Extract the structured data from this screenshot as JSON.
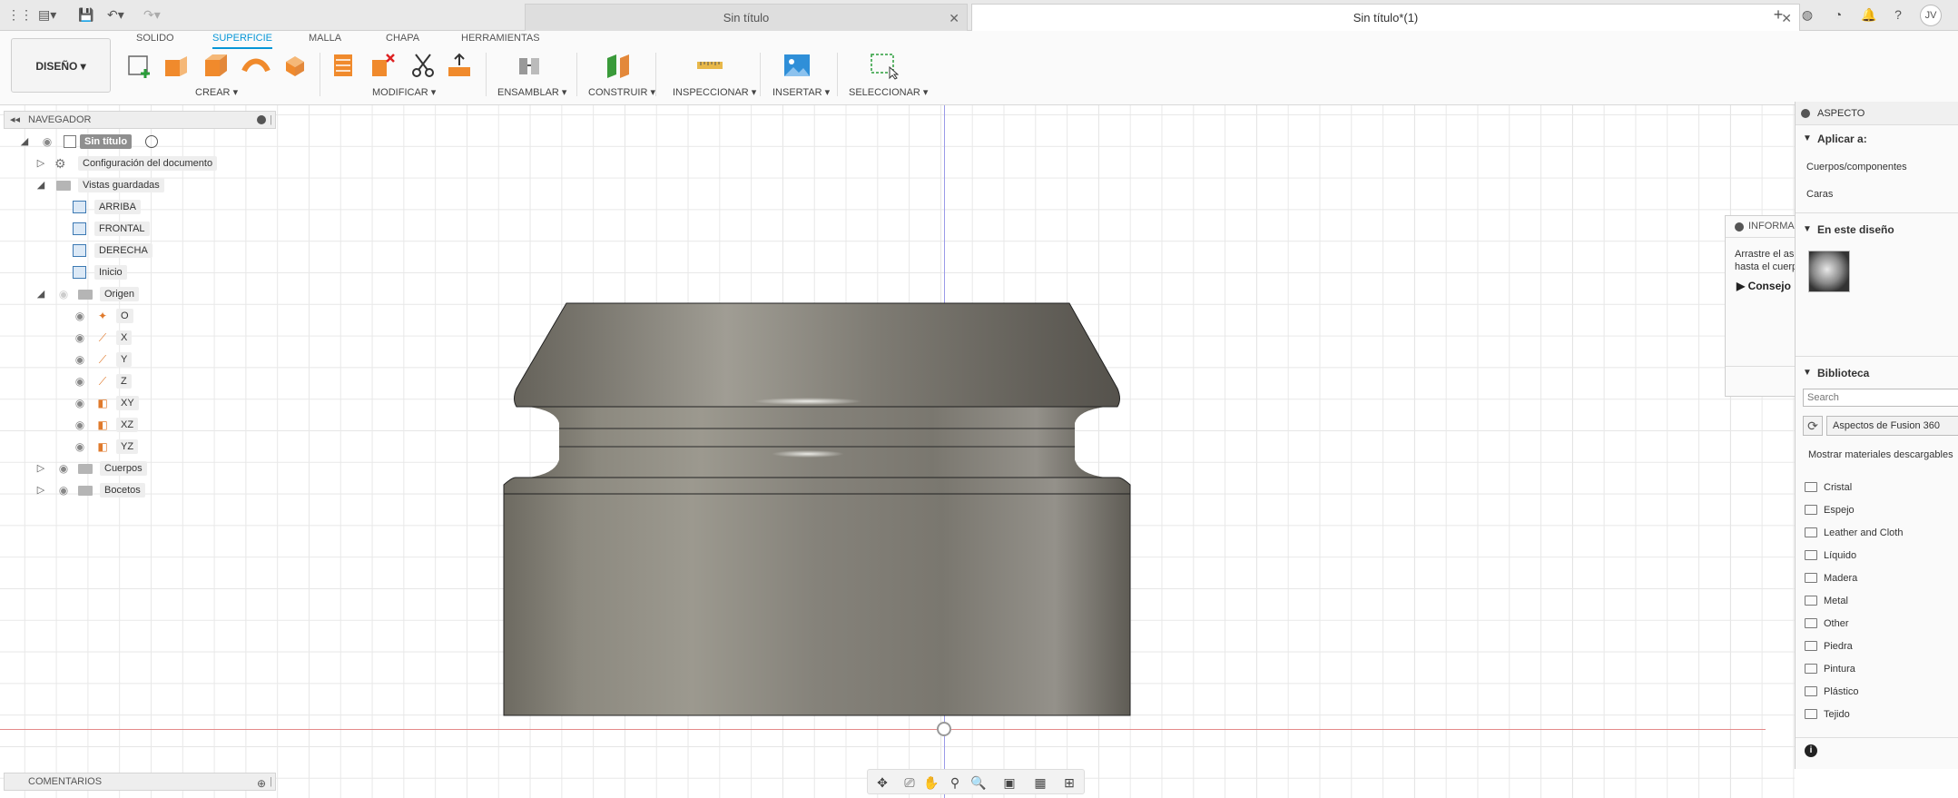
{
  "title_bar": {
    "tabs": [
      {
        "label": "Sin título",
        "active": false
      },
      {
        "label": "Sin título*(1)",
        "active": true
      }
    ],
    "user_initials": "JV"
  },
  "ribbon": {
    "workspace": "DISEÑO",
    "tabs": [
      "SOLIDO",
      "SUPERFICIE",
      "MALLA",
      "CHAPA",
      "HERRAMIENTAS"
    ],
    "active_tab": "SUPERFICIE",
    "groups": [
      "CREAR",
      "MODIFICAR",
      "ENSAMBLAR",
      "CONSTRUIR",
      "INSPECCIONAR",
      "INSERTAR",
      "SELECCIONAR"
    ]
  },
  "navigator": {
    "title": "NAVEGADOR",
    "root": "Sin título",
    "doc_settings": "Configuración del documento",
    "saved_views": "Vistas guardadas",
    "views": [
      "ARRIBA",
      "FRONTAL",
      "DERECHA",
      "Inicio"
    ],
    "origin": "Origen",
    "origin_items": [
      "O",
      "X",
      "Y",
      "Z",
      "XY",
      "XZ",
      "YZ"
    ],
    "bodies": "Cuerpos",
    "sketches": "Bocetos"
  },
  "comments": {
    "title": "COMENTARIOS"
  },
  "info_popup": {
    "title": "INFORMAC",
    "line1": "Arrastre el as",
    "line2": "hasta el cuerp",
    "tips": "Consejo"
  },
  "appearance": {
    "title": "ASPECTO",
    "apply_to": "Aplicar a:",
    "options": [
      "Cuerpos/componentes",
      "Caras"
    ],
    "in_design": "En este diseño",
    "library": "Biblioteca",
    "search_placeholder": "Search",
    "library_source": "Aspectos de Fusion 360",
    "show_downloadable": "Mostrar materiales descargables",
    "materials": [
      "Cristal",
      "Espejo",
      "Leather and Cloth",
      "Líquido",
      "Madera",
      "Metal",
      "Other",
      "Piedra",
      "Pintura",
      "Plástico",
      "Tejido"
    ]
  },
  "colors": {
    "accent": "#0696d7",
    "red_axis": "#e07070",
    "blue_axis": "#8080e0"
  }
}
